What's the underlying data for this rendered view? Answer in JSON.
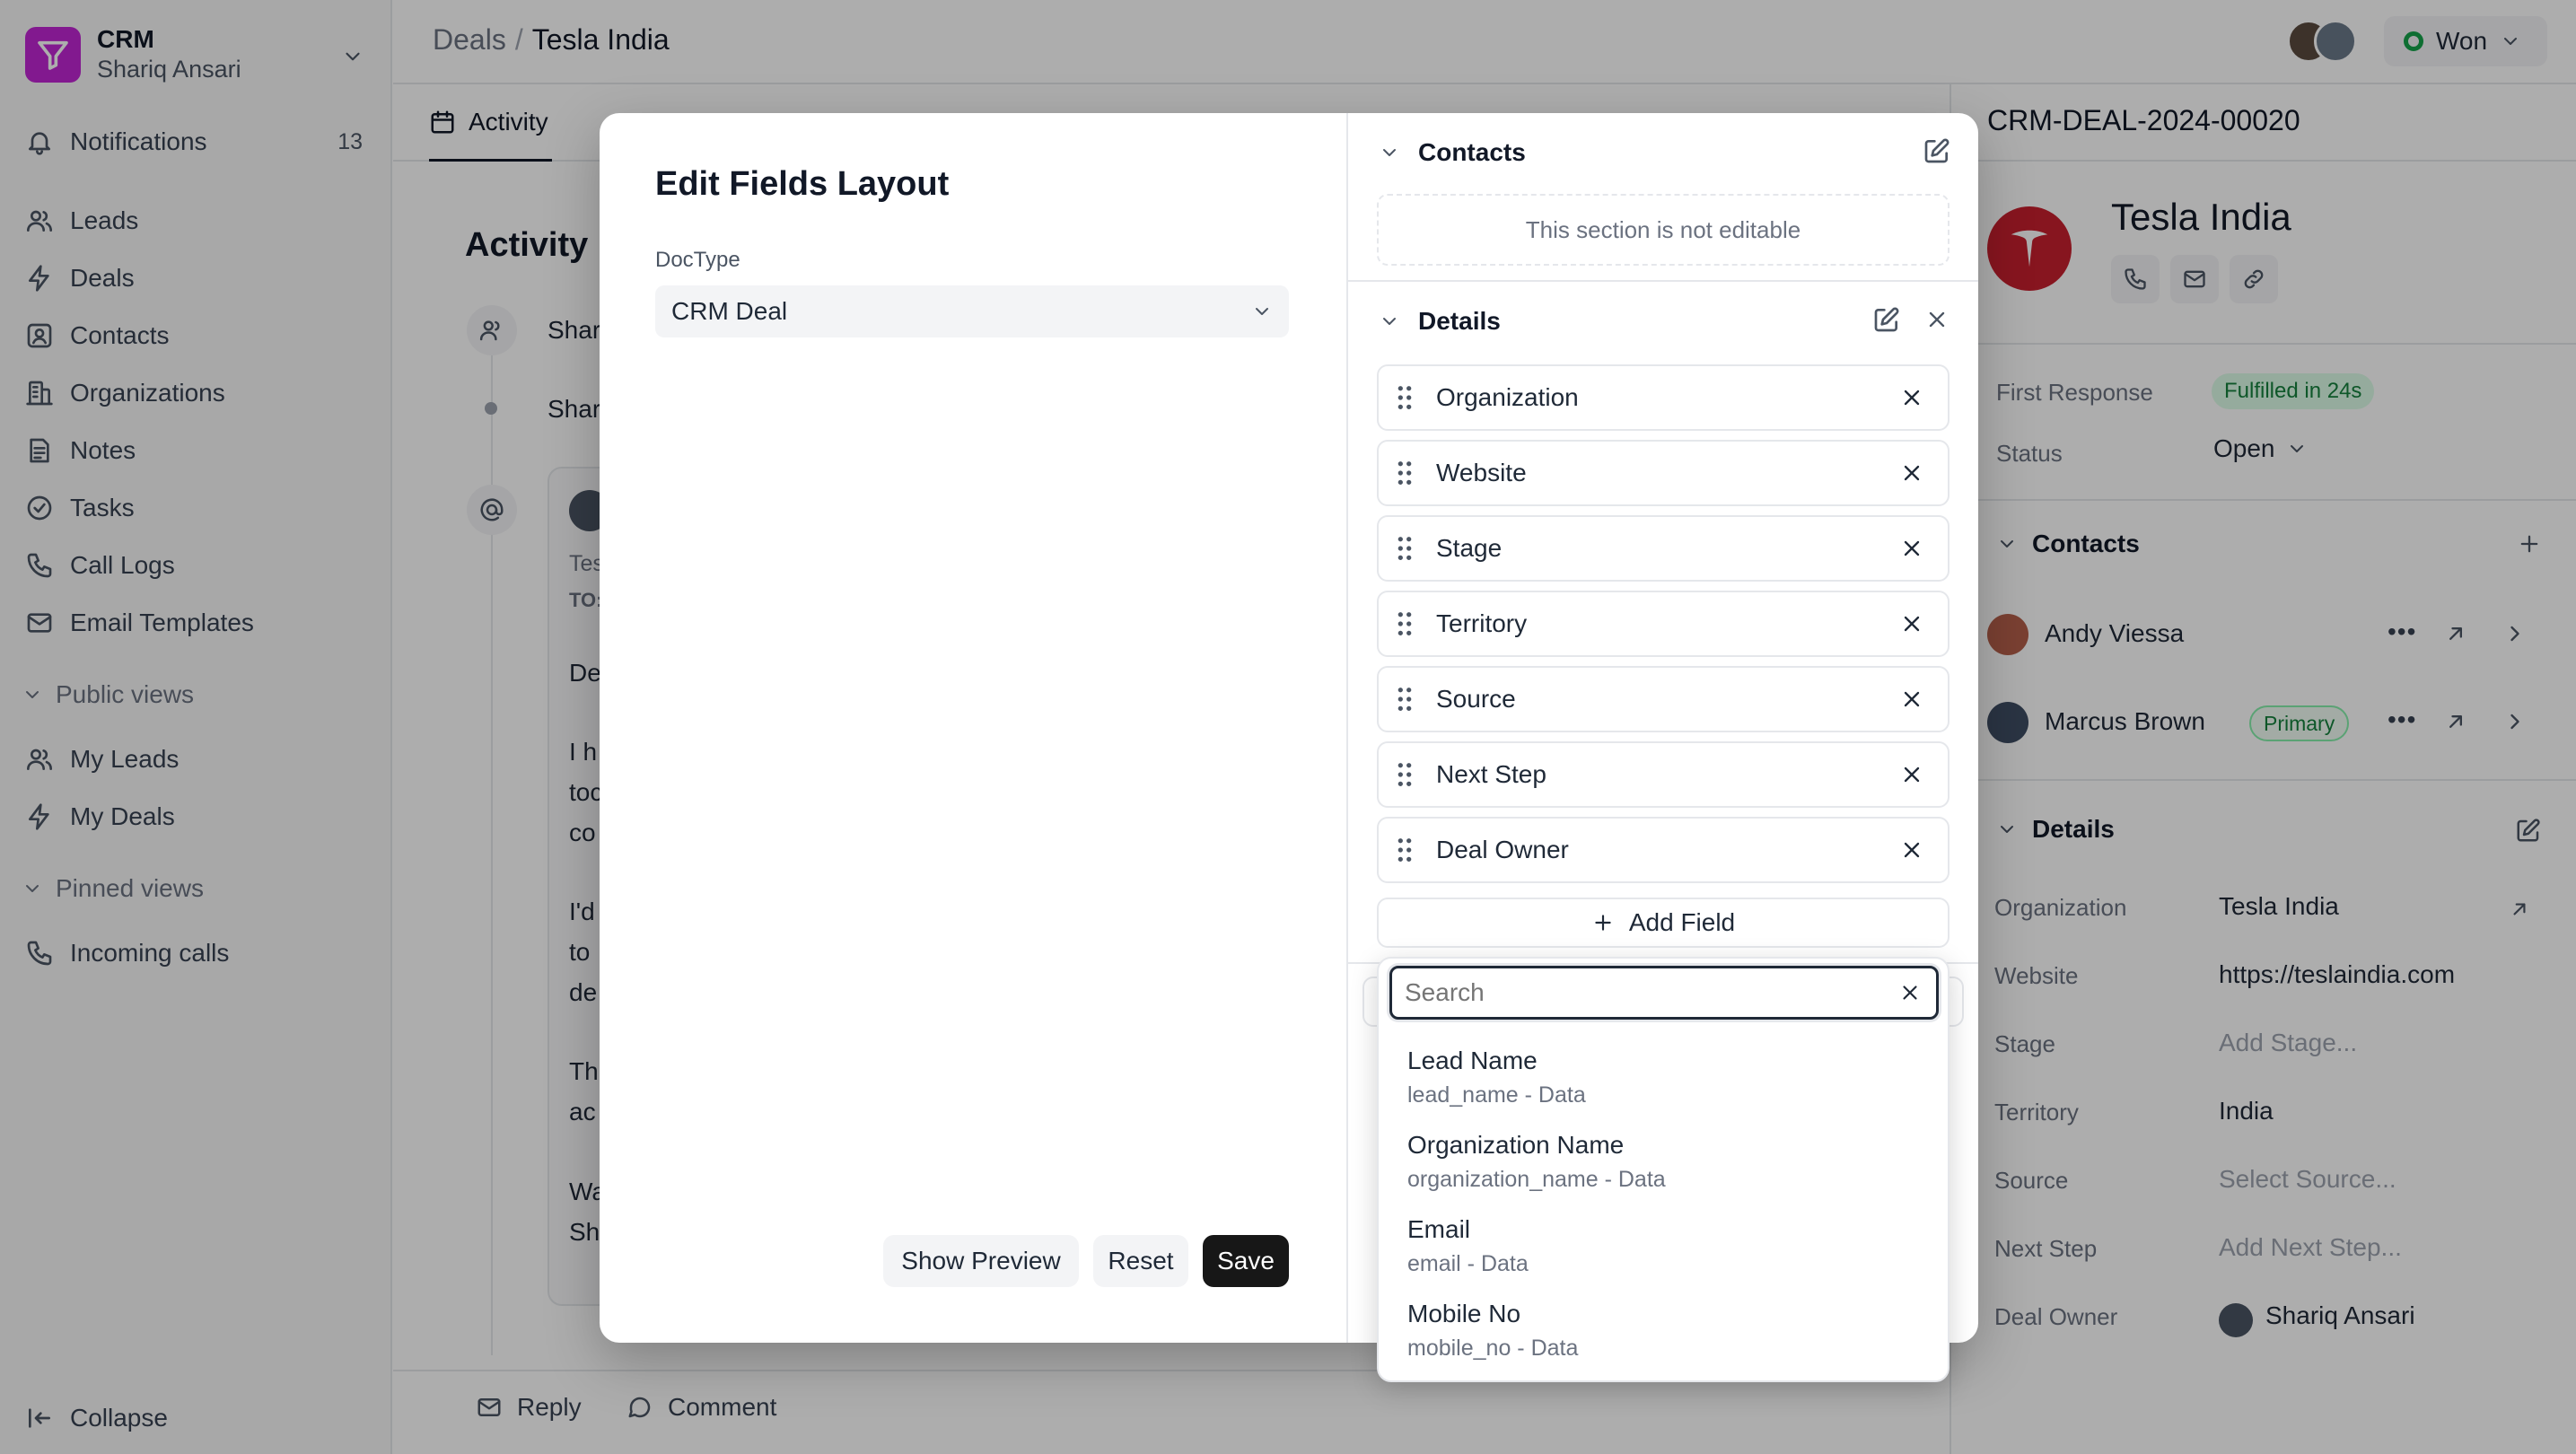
{
  "app": {
    "name": "CRM",
    "user": "Shariq Ansari"
  },
  "sidebar": {
    "notifications": {
      "label": "Notifications",
      "count": "13"
    },
    "items": [
      {
        "label": "Leads",
        "icon": "users-icon"
      },
      {
        "label": "Deals",
        "icon": "lightning-icon"
      },
      {
        "label": "Contacts",
        "icon": "contact-card-icon"
      },
      {
        "label": "Organizations",
        "icon": "building-icon"
      },
      {
        "label": "Notes",
        "icon": "note-icon"
      },
      {
        "label": "Tasks",
        "icon": "check-circle-icon"
      },
      {
        "label": "Call Logs",
        "icon": "phone-icon"
      },
      {
        "label": "Email Templates",
        "icon": "mail-icon"
      }
    ],
    "public_views": {
      "label": "Public views",
      "items": [
        "My Leads",
        "My Deals"
      ]
    },
    "pinned_views": {
      "label": "Pinned views",
      "items": [
        "Incoming calls"
      ]
    },
    "collapse": "Collapse"
  },
  "breadcrumb": {
    "parent": "Deals",
    "separator": "/",
    "current": "Tesla India"
  },
  "status_button": {
    "label": "Won",
    "color": "#16a34a"
  },
  "tabs": {
    "active": "Activity"
  },
  "activity": {
    "heading": "Activity",
    "row1": "Shar",
    "row2": "Shar",
    "email_meta1": "Tes",
    "email_meta2": "TO:",
    "email_lines": [
      "De",
      "I h",
      "toc",
      "co",
      "I'd",
      "to",
      "de",
      "Th",
      "ac",
      "Wa",
      "Sh"
    ]
  },
  "bottom_bar": {
    "reply": "Reply",
    "comment": "Comment"
  },
  "right_panel": {
    "deal_id": "CRM-DEAL-2024-00020",
    "org_name": "Tesla India",
    "first_response_label": "First Response",
    "first_response_value": "Fulfilled in 24s",
    "status_label": "Status",
    "status_value": "Open",
    "contacts_heading": "Contacts",
    "contacts": [
      {
        "name": "Andy Viessa",
        "badge": ""
      },
      {
        "name": "Marcus Brown",
        "badge": "Primary"
      }
    ],
    "details_heading": "Details",
    "details": [
      {
        "label": "Organization",
        "value": "Tesla India",
        "placeholder": false
      },
      {
        "label": "Website",
        "value": "https://teslaindia.com",
        "placeholder": false
      },
      {
        "label": "Stage",
        "value": "Add Stage...",
        "placeholder": true
      },
      {
        "label": "Territory",
        "value": "India",
        "placeholder": false
      },
      {
        "label": "Source",
        "value": "Select Source...",
        "placeholder": true
      },
      {
        "label": "Next Step",
        "value": "Add Next Step...",
        "placeholder": true
      },
      {
        "label": "Deal Owner",
        "value": "Shariq Ansari",
        "placeholder": false
      }
    ]
  },
  "modal": {
    "title": "Edit Fields Layout",
    "doctype_label": "DocType",
    "doctype_value": "CRM Deal",
    "buttons": {
      "preview": "Show Preview",
      "reset": "Reset",
      "save": "Save"
    },
    "contacts_section": {
      "title": "Contacts",
      "note": "This section is not editable"
    },
    "details_section": {
      "title": "Details",
      "fields": [
        "Organization",
        "Website",
        "Stage",
        "Territory",
        "Source",
        "Next Step",
        "Deal Owner"
      ],
      "add_field": "Add Field"
    }
  },
  "dropdown": {
    "search_placeholder": "Search",
    "options": [
      {
        "label": "Lead Name",
        "meta": "lead_name - Data"
      },
      {
        "label": "Organization Name",
        "meta": "organization_name - Data"
      },
      {
        "label": "Email",
        "meta": "email - Data"
      },
      {
        "label": "Mobile No",
        "meta": "mobile_no - Data"
      }
    ]
  }
}
